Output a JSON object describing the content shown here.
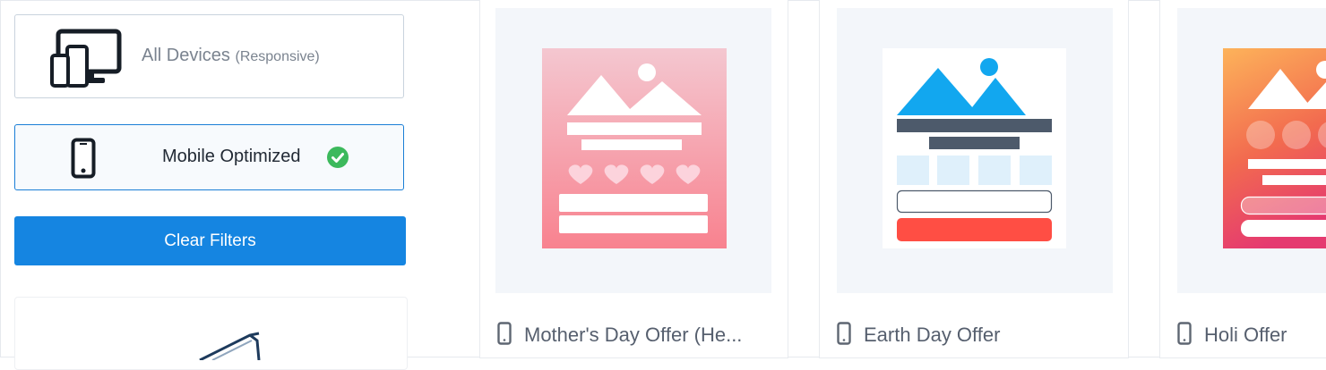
{
  "sidebar": {
    "filters": [
      {
        "label": "All Devices",
        "sub": "(Responsive)",
        "icon": "devices-icon",
        "selected": false
      },
      {
        "label": "Mobile Optimized",
        "icon": "mobile-phone-icon",
        "selected": true,
        "status_icon": "check-circle-icon"
      }
    ],
    "clear_button": "Clear Filters"
  },
  "templates": [
    {
      "title": "Mother's Day Offer (He...",
      "icon": "mobile-phone-icon",
      "theme": "pink-hearts"
    },
    {
      "title": "Earth Day Offer",
      "icon": "mobile-phone-icon",
      "theme": "blue-form"
    },
    {
      "title": "Holi Offer",
      "icon": "mobile-phone-icon",
      "theme": "orange-gradient"
    }
  ],
  "colors": {
    "accent": "#1585e1",
    "check_green": "#3cb95c",
    "earth_blue": "#12a7ef",
    "earth_red": "#ff4e44"
  }
}
